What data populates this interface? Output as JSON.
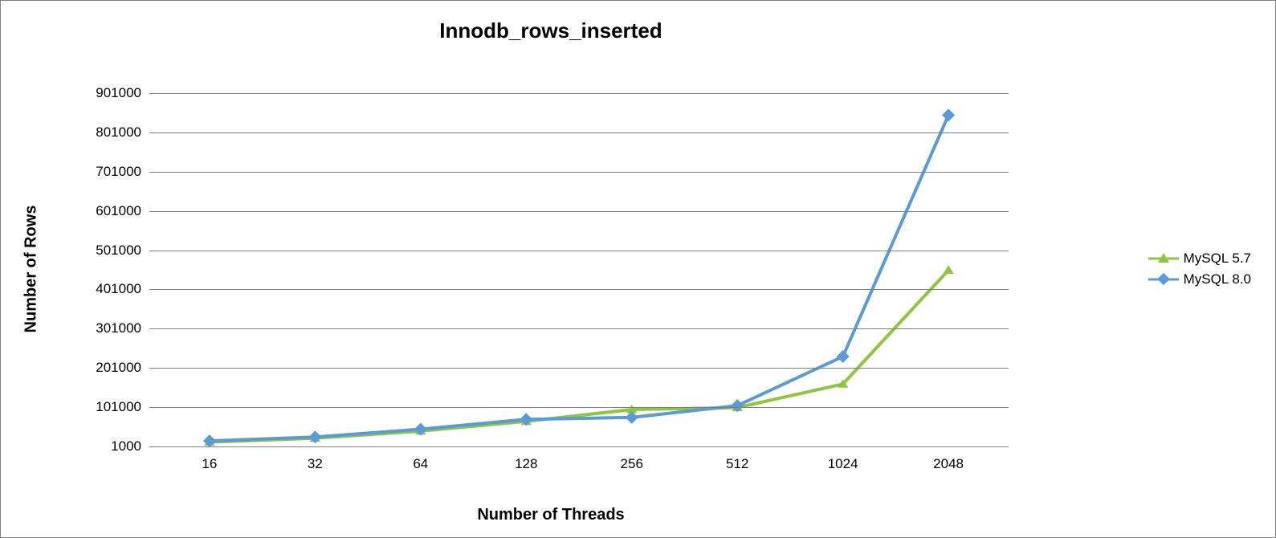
{
  "chart_data": {
    "type": "line",
    "title": "Innodb_rows_inserted",
    "xlabel": "Number of Threads",
    "ylabel": "Number of Rows",
    "categories": [
      "16",
      "32",
      "64",
      "128",
      "256",
      "512",
      "1024",
      "2048"
    ],
    "y_ticks": [
      1000,
      101000,
      201000,
      301000,
      401000,
      501000,
      601000,
      701000,
      801000,
      901000
    ],
    "ylim": [
      1000,
      901000
    ],
    "series": [
      {
        "name": "MySQL 5.7",
        "color": "#8EC63F",
        "marker": "triangle",
        "values": [
          12000,
          22000,
          40000,
          65000,
          95000,
          100000,
          160000,
          450000
        ]
      },
      {
        "name": "MySQL 8.0",
        "color": "#5B9BD5",
        "marker": "diamond",
        "values": [
          15000,
          25000,
          45000,
          70000,
          75000,
          105000,
          230000,
          845000
        ]
      }
    ]
  }
}
